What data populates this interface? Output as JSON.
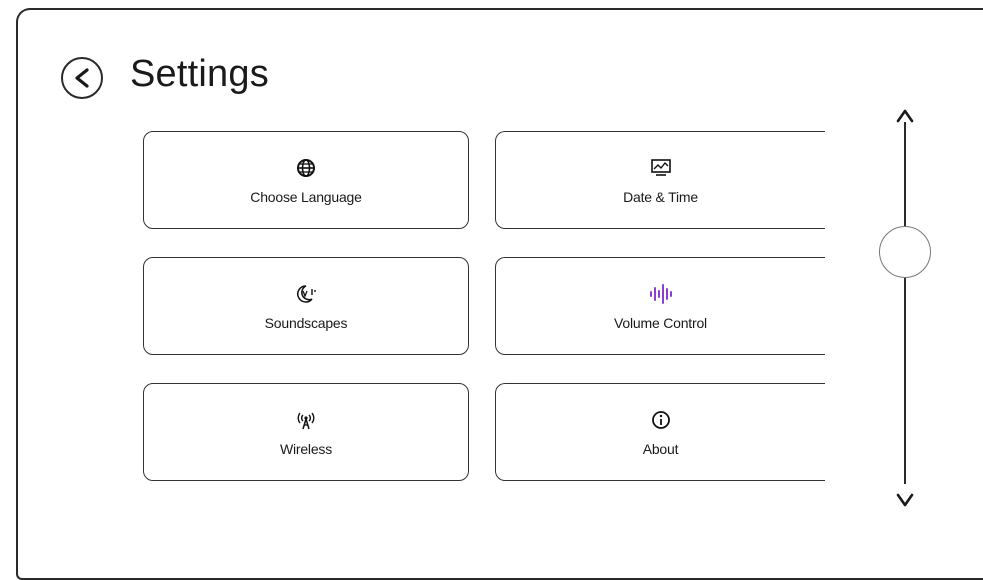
{
  "header": {
    "title": "Settings",
    "back_icon": "chevron-left-icon"
  },
  "tiles": [
    {
      "label": "Choose Language",
      "icon": "globe-icon"
    },
    {
      "label": "Date & Time",
      "icon": "monitor-chart-icon"
    },
    {
      "label": "Soundscapes",
      "icon": "moon-sound-icon"
    },
    {
      "label": "Volume Control",
      "icon": "sound-wave-icon"
    },
    {
      "label": "Wireless",
      "icon": "wireless-tower-icon"
    },
    {
      "label": "About",
      "icon": "info-icon"
    }
  ],
  "scrollbar": {
    "up_icon": "chevron-up-icon",
    "down_icon": "chevron-down-icon"
  },
  "colors": {
    "accent": "#8a3fd1",
    "stroke": "#2a2a2a"
  }
}
